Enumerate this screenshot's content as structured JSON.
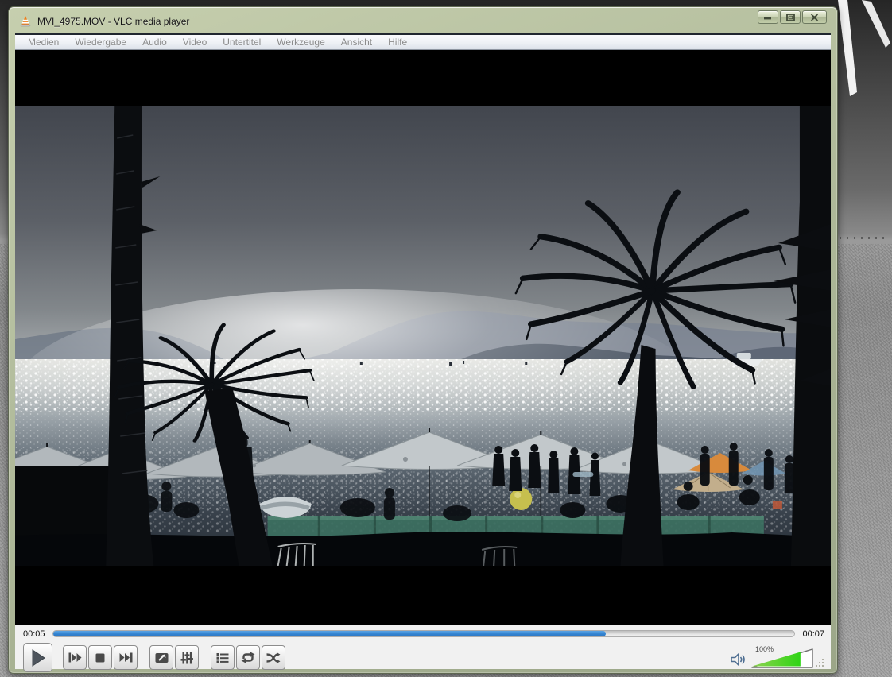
{
  "window": {
    "title": "MVI_4975.MOV - VLC media player",
    "app_icon": "vlc-cone-icon",
    "controls": {
      "minimize": "minimize",
      "maximize": "maximize",
      "close": "close"
    }
  },
  "menu": {
    "items": [
      "Medien",
      "Wiedergabe",
      "Audio",
      "Video",
      "Untertitel",
      "Werkzeuge",
      "Ansicht",
      "Hilfe"
    ]
  },
  "video": {
    "alt": "Backlit beach scene: dark palm silhouettes, hazy mountains, sun glitter on the sea, white beach umbrellas and crowd, small boat on horizon"
  },
  "transport": {
    "elapsed": "00:05",
    "duration": "00:07",
    "progress_pct": 74.5,
    "progress_style": "width:74.5%"
  },
  "controls": {
    "icons": {
      "play": "play-triangle",
      "previous": "skip-back",
      "stop": "stop-square",
      "next": "skip-forward",
      "fullscreen": "window-arrow",
      "extended_settings": "equalizer-sliders",
      "playlist": "list",
      "loop": "cycle-arrows",
      "random": "crossed-arrows"
    }
  },
  "volume": {
    "label": "100%",
    "level_pct": 78,
    "level_style": "width:78%",
    "icon": "speaker-waves"
  },
  "colors": {
    "progress_blue": "#3585d2",
    "volume_green": "#2fd416",
    "frame_green": "#b3bd9d",
    "menubar_text": "#8c8c8c"
  }
}
